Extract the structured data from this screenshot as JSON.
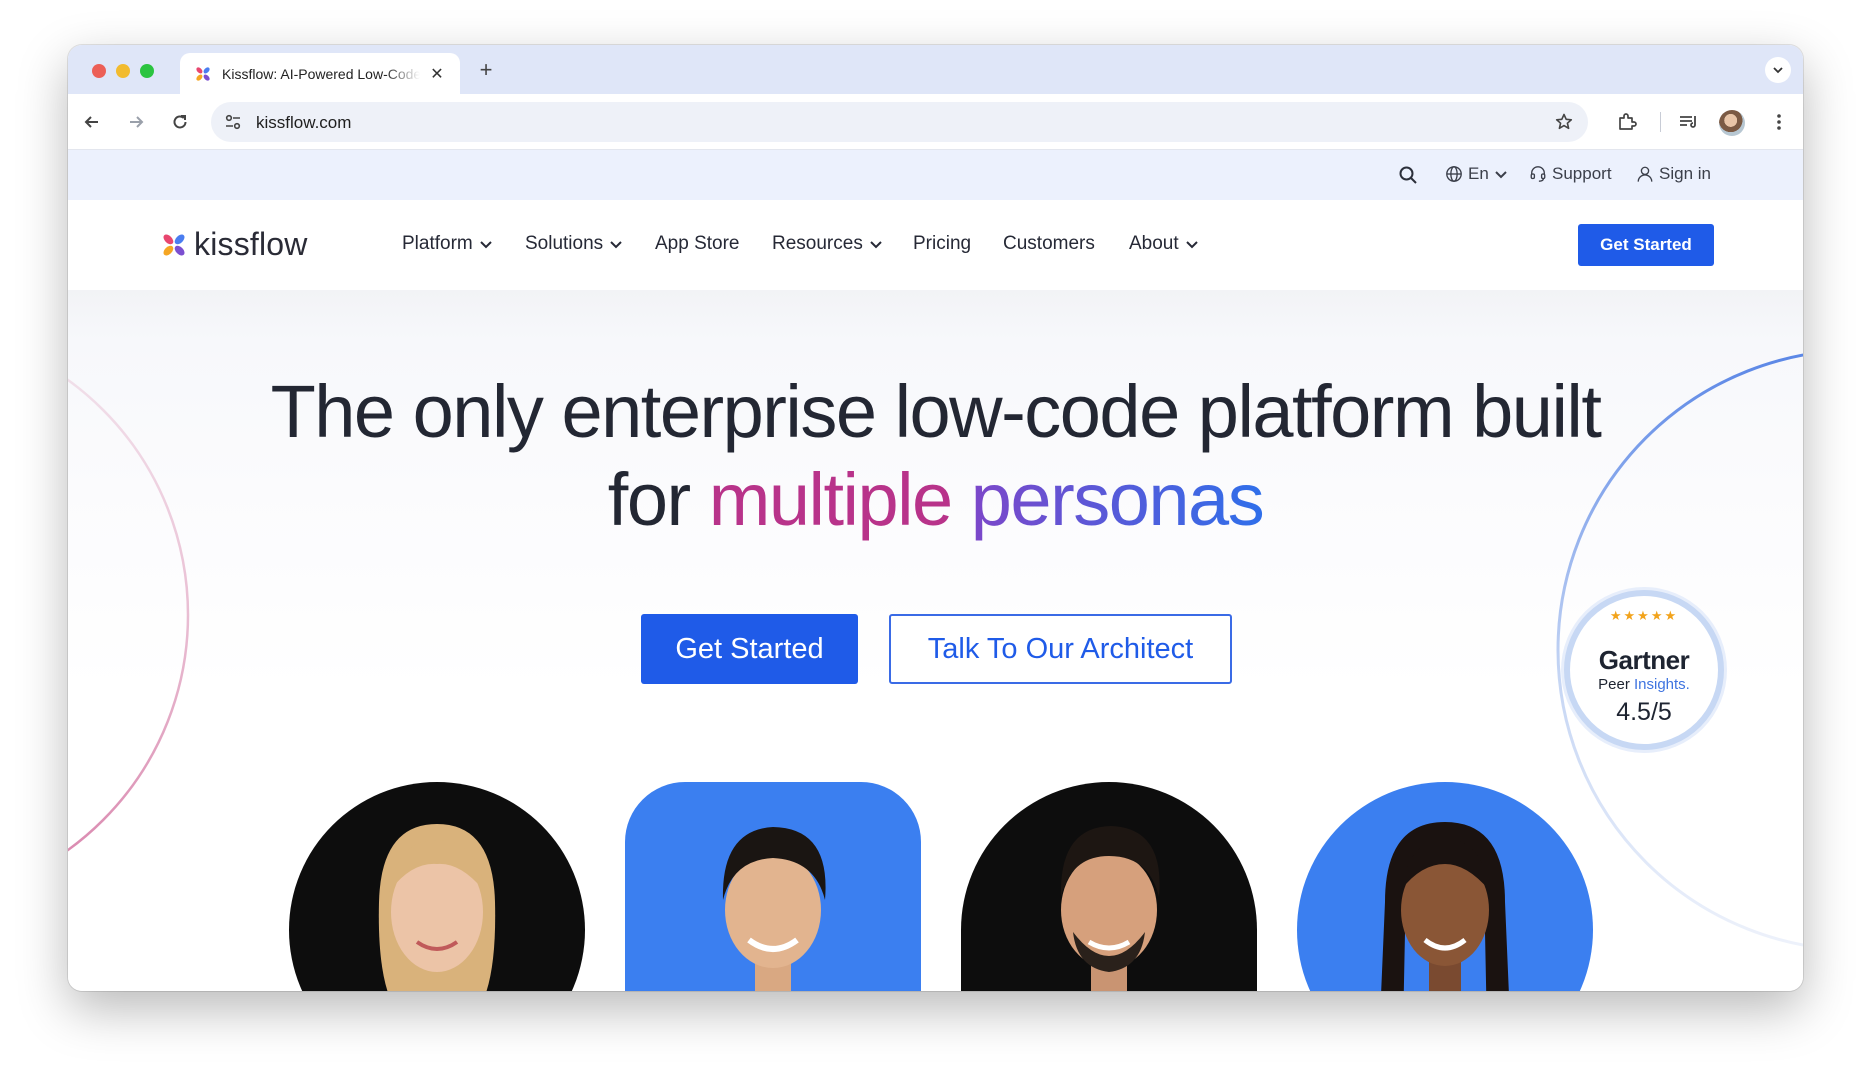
{
  "browser": {
    "tab_title": "Kissflow: AI-Powered Low-Code",
    "url": "kissflow.com"
  },
  "utility_bar": {
    "language": "En",
    "support": "Support",
    "signin": "Sign in"
  },
  "nav": {
    "logo": "kissflow",
    "items": [
      {
        "label": "Platform",
        "dropdown": true
      },
      {
        "label": "Solutions",
        "dropdown": true
      },
      {
        "label": "App Store",
        "dropdown": false
      },
      {
        "label": "Resources",
        "dropdown": true
      },
      {
        "label": "Pricing",
        "dropdown": false
      },
      {
        "label": "Customers",
        "dropdown": false
      },
      {
        "label": "About",
        "dropdown": true
      }
    ],
    "cta": "Get Started"
  },
  "hero": {
    "title_line1": "The only enterprise low-code platform built",
    "title_line2_prefix": "for",
    "title_highlight_1": "multiple",
    "title_highlight_2": "personas",
    "primary_button": "Get Started",
    "secondary_button": "Talk To Our Architect",
    "highlight_colors": [
      "#b8338a",
      "#7c47c9",
      "#2f6fea"
    ]
  },
  "gartner": {
    "name": "Gartner",
    "peer": "Peer",
    "insights": "Insights.",
    "score": "4.5/5",
    "stars": "★★★★★"
  },
  "colors": {
    "brand_blue": "#1f5be8",
    "utility_bg": "#ecf1fd",
    "persona_blue": "#3b7ff0",
    "persona_black": "#0d0d0d"
  },
  "icons": [
    "search-icon",
    "globe-icon",
    "headset-icon",
    "user-icon",
    "star-icon",
    "extensions-icon",
    "reading-list-icon",
    "kebab-menu-icon"
  ]
}
